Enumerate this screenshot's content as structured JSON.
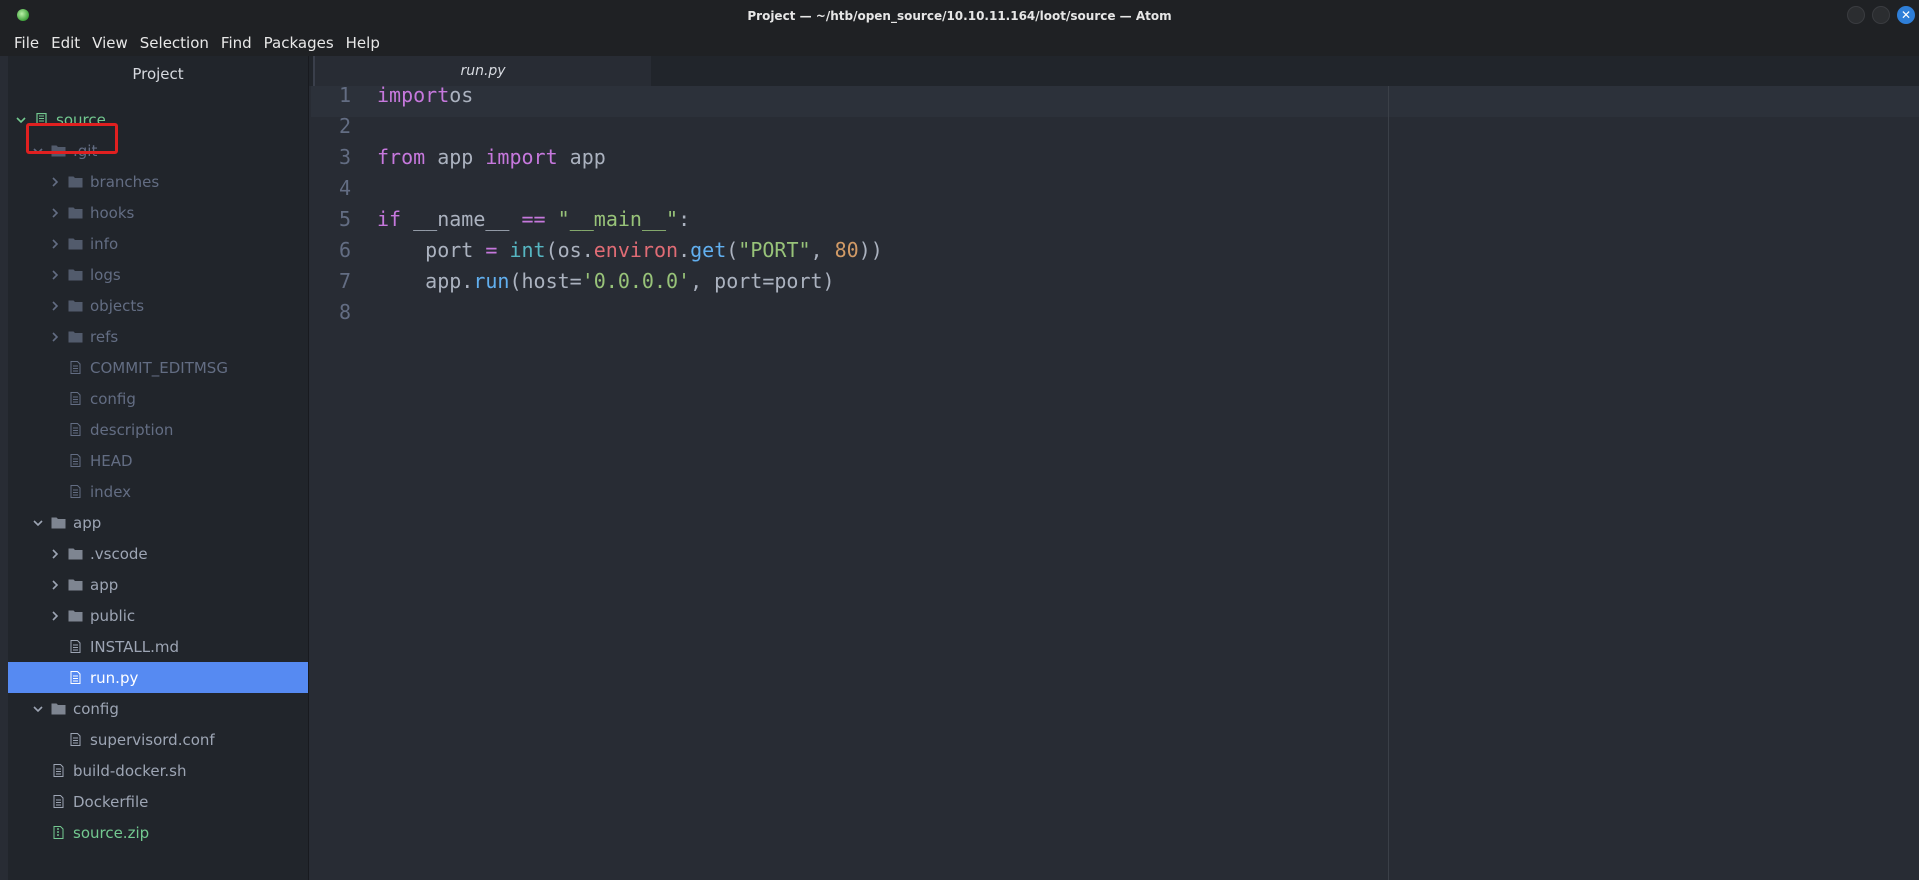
{
  "window": {
    "title": "Project — ~/htb/open_source/10.10.11.164/loot/source — Atom",
    "close_glyph": "✕"
  },
  "menu": [
    "File",
    "Edit",
    "View",
    "Selection",
    "Find",
    "Packages",
    "Help"
  ],
  "sidebar": {
    "header": "Project",
    "tree": [
      {
        "label": "source",
        "kind": "repo",
        "expanded": true,
        "depth": 0,
        "style": "green"
      },
      {
        "label": ".git",
        "kind": "folder",
        "expanded": true,
        "depth": 1,
        "style": "dim"
      },
      {
        "label": "branches",
        "kind": "folder",
        "expanded": false,
        "depth": 2,
        "style": "dim"
      },
      {
        "label": "hooks",
        "kind": "folder",
        "expanded": false,
        "depth": 2,
        "style": "dim"
      },
      {
        "label": "info",
        "kind": "folder",
        "expanded": false,
        "depth": 2,
        "style": "dim"
      },
      {
        "label": "logs",
        "kind": "folder",
        "expanded": false,
        "depth": 2,
        "style": "dim"
      },
      {
        "label": "objects",
        "kind": "folder",
        "expanded": false,
        "depth": 2,
        "style": "dim"
      },
      {
        "label": "refs",
        "kind": "folder",
        "expanded": false,
        "depth": 2,
        "style": "dim"
      },
      {
        "label": "COMMIT_EDITMSG",
        "kind": "file",
        "depth": 2,
        "style": "dim"
      },
      {
        "label": "config",
        "kind": "file",
        "depth": 2,
        "style": "dim"
      },
      {
        "label": "description",
        "kind": "file",
        "depth": 2,
        "style": "dim"
      },
      {
        "label": "HEAD",
        "kind": "file",
        "depth": 2,
        "style": "dim"
      },
      {
        "label": "index",
        "kind": "file",
        "depth": 2,
        "style": "dim"
      },
      {
        "label": "app",
        "kind": "folder",
        "expanded": true,
        "depth": 1,
        "style": "normal"
      },
      {
        "label": ".vscode",
        "kind": "folder",
        "expanded": false,
        "depth": 2,
        "style": "normal"
      },
      {
        "label": "app",
        "kind": "folder",
        "expanded": false,
        "depth": 2,
        "style": "normal"
      },
      {
        "label": "public",
        "kind": "folder",
        "expanded": false,
        "depth": 2,
        "style": "normal"
      },
      {
        "label": "INSTALL.md",
        "kind": "file",
        "depth": 2,
        "style": "normal"
      },
      {
        "label": "run.py",
        "kind": "file",
        "depth": 2,
        "style": "selected"
      },
      {
        "label": "config",
        "kind": "folder",
        "expanded": true,
        "depth": 1,
        "style": "normal"
      },
      {
        "label": "supervisord.conf",
        "kind": "file",
        "depth": 2,
        "style": "normal"
      },
      {
        "label": "build-docker.sh",
        "kind": "file",
        "depth": 1,
        "style": "normal"
      },
      {
        "label": "Dockerfile",
        "kind": "file",
        "depth": 1,
        "style": "normal"
      },
      {
        "label": "source.zip",
        "kind": "zip",
        "depth": 1,
        "style": "green"
      }
    ]
  },
  "editor": {
    "tab": "run.py",
    "lines": [
      [
        [
          "kw",
          "import"
        ],
        [
          "",
          "os"
        ]
      ],
      [],
      [
        [
          "kw",
          "from"
        ],
        [
          "",
          " app "
        ],
        [
          "kw",
          "import"
        ],
        [
          "",
          " app"
        ]
      ],
      [],
      [
        [
          "kw",
          "if"
        ],
        [
          "",
          " __name__ "
        ],
        [
          "kw",
          "=="
        ],
        [
          "",
          " "
        ],
        [
          "str",
          "\"__main__\""
        ],
        [
          "",
          ":"
        ]
      ],
      [
        [
          "",
          "    port "
        ],
        [
          "kw",
          "="
        ],
        [
          "",
          " "
        ],
        [
          "bi",
          "int"
        ],
        [
          "",
          "(os."
        ],
        [
          "attr",
          "environ"
        ],
        [
          "",
          "."
        ],
        [
          "fn",
          "get"
        ],
        [
          "",
          "("
        ],
        [
          "str",
          "\"PORT\""
        ],
        [
          "",
          ", "
        ],
        [
          "num",
          "80"
        ],
        [
          "",
          "))"
        ]
      ],
      [
        [
          "",
          "    app."
        ],
        [
          "fn",
          "run"
        ],
        [
          "",
          "(host="
        ],
        [
          "str",
          "'0.0.0.0'"
        ],
        [
          "",
          ", port=port)"
        ]
      ],
      []
    ]
  },
  "colors": {
    "selection": "#568af2",
    "highlight_box": "#e02020",
    "git_added": "#73c990",
    "keyword": "#c678dd",
    "string": "#98c379"
  }
}
